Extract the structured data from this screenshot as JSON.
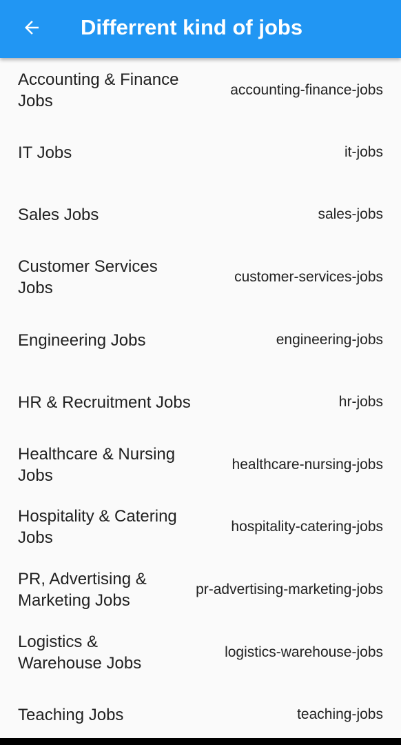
{
  "app_bar": {
    "title": "Differrent kind of jobs",
    "back_icon": "arrow-back-icon",
    "color": "#2196f3"
  },
  "jobs": [
    {
      "title": "Accounting & Finance Jobs",
      "slug": "accounting-finance-jobs"
    },
    {
      "title": "IT Jobs",
      "slug": "it-jobs"
    },
    {
      "title": "Sales Jobs",
      "slug": "sales-jobs"
    },
    {
      "title": "Customer Services Jobs",
      "slug": "customer-services-jobs"
    },
    {
      "title": "Engineering Jobs",
      "slug": "engineering-jobs"
    },
    {
      "title": "HR & Recruitment Jobs",
      "slug": "hr-jobs"
    },
    {
      "title": "Healthcare & Nursing Jobs",
      "slug": "healthcare-nursing-jobs"
    },
    {
      "title": "Hospitality & Catering Jobs",
      "slug": "hospitality-catering-jobs"
    },
    {
      "title": "PR, Advertising & Marketing Jobs",
      "slug": "pr-advertising-marketing-jobs"
    },
    {
      "title": "Logistics & Warehouse Jobs",
      "slug": "logistics-warehouse-jobs"
    },
    {
      "title": "Teaching Jobs",
      "slug": "teaching-jobs"
    }
  ]
}
